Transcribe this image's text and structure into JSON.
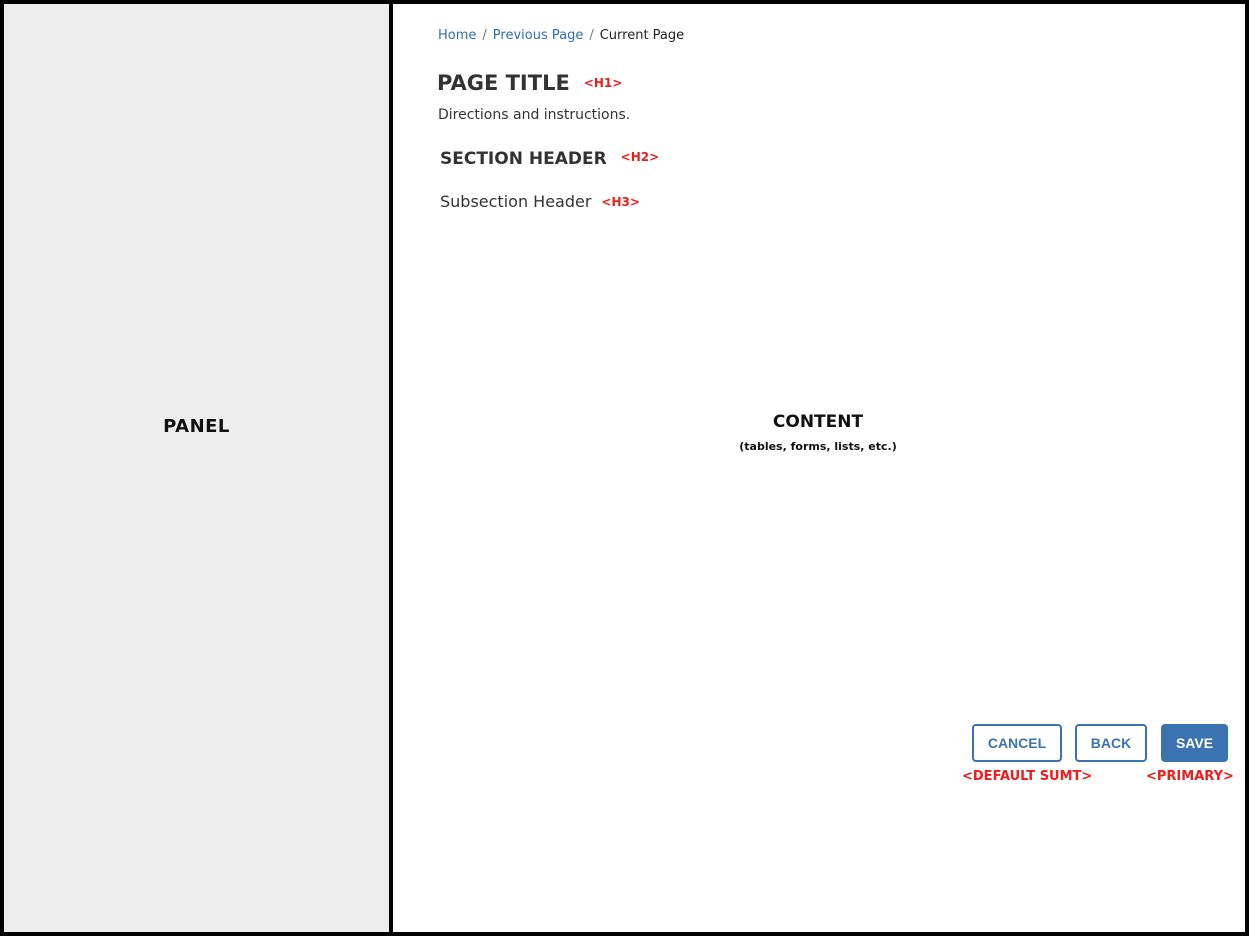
{
  "panel": {
    "label": "PANEL"
  },
  "breadcrumb": {
    "items": [
      "Home",
      "Previous Page"
    ],
    "separator": "/",
    "current": "Current Page"
  },
  "header": {
    "title": "PAGE TITLE",
    "title_tag": "<H1>",
    "directions": "Directions and instructions.",
    "section": "SECTION HEADER",
    "section_tag": "<H2>",
    "subsection": "Subsection Header",
    "subsection_tag": "<H3>"
  },
  "content": {
    "label": "CONTENT",
    "sublabel": "(tables, forms, lists, etc.)"
  },
  "actions": {
    "cancel_label": "CANCEL",
    "back_label": "BACK",
    "save_label": "SAVE",
    "default_tag": "<DEFAULT SUMT>",
    "primary_tag": "<PRIMARY>"
  },
  "colors": {
    "accent": "#3b73b0",
    "annotation": "#ee1c1c",
    "panel_bg": "#ededed",
    "link": "#2f6db3"
  }
}
